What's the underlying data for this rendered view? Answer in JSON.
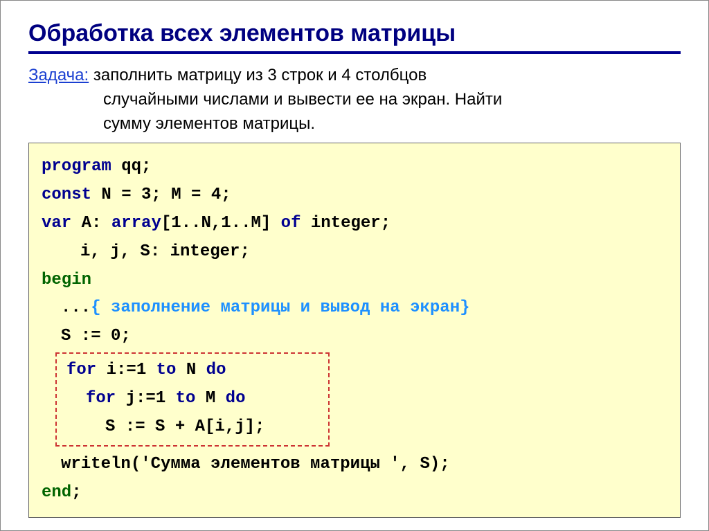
{
  "title": "Обработка всех элементов матрицы",
  "task": {
    "label": "Задача:",
    "line1": "заполнить матрицу из 3 строк и 4 столбцов",
    "line2": "случайными числами и вывести ее на экран. Найти",
    "line3": "сумму элементов матрицы."
  },
  "code": {
    "l1_kw": "program",
    "l1_rest": " qq;",
    "l2_kw": "const",
    "l2_rest": " N = 3; M = 4;",
    "l3_kw": "var",
    "l3_mid": " A: ",
    "l3_kw2": "array",
    "l3_rest": "[1..N,1..M] ",
    "l3_kw3": "of",
    "l3_rest2": " integer;",
    "l4": "i, j, S: integer;",
    "l5_kw": "begin",
    "l6_dots": "... ",
    "l6_comment": "{ заполнение матрицы и вывод на экран}",
    "l7": "S := 0;",
    "f1_kw": "for",
    "f1_mid": " i:=1 ",
    "f1_kw2": "to",
    "f1_mid2": " N ",
    "f1_kw3": "do",
    "f2_kw": "for",
    "f2_mid": " j:=1 ",
    "f2_kw2": "to",
    "f2_mid2": " M ",
    "f2_kw3": "do",
    "f3": "S := S + A[i,j];",
    "l8": "writeln('Сумма элементов матрицы ', S);",
    "l9_kw": "end",
    "l9_rest": ";"
  }
}
